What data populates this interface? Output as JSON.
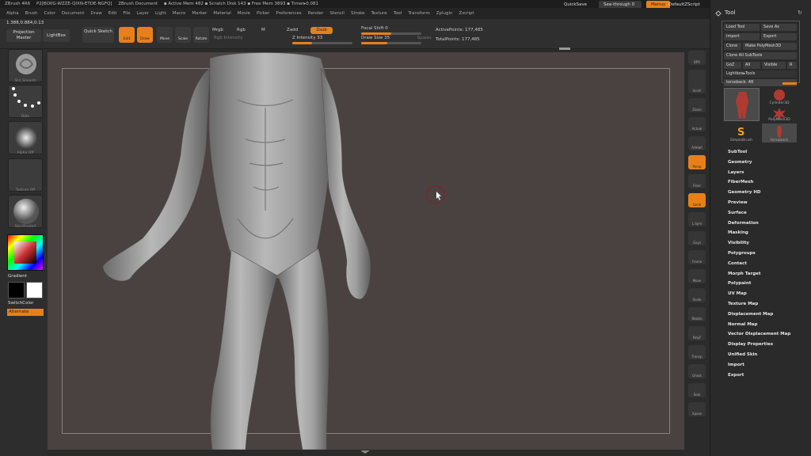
{
  "titlebar": {
    "segments": [
      "ZBrush 4R6",
      "P2[BO0G-WZZE-QIXN-ETDE-NGFQ]",
      "ZBrush Document",
      "▪ Active Mem 482 ▪ Scratch Disk 143 ▪ Free Mem 3893 ▪ Timer▸0.081"
    ],
    "quicksave": "QuickSave",
    "seethrough": "See-through   0",
    "menus": "Menus",
    "defaultzscript": "DefaultZScript"
  },
  "menubar": [
    "Alpha",
    "Brush",
    "Color",
    "Document",
    "Draw",
    "Edit",
    "File",
    "Layer",
    "Light",
    "Macro",
    "Marker",
    "Material",
    "Movie",
    "Picker",
    "Preferences",
    "Render",
    "Stencil",
    "Stroke",
    "Texture",
    "Tool",
    "Transform",
    "Zplugin",
    "Zscript"
  ],
  "coords": "1.388,0.884,0.13",
  "shelf": {
    "projection_master": "Projection Master",
    "lightbox": "LightBox",
    "quick_sketch": "Quick Sketch",
    "edit": "Edit",
    "draw": "Draw",
    "move": "Move",
    "scale": "Scale",
    "rotate": "Rotate",
    "mrgb": "Mrgb",
    "rgb": "Rgb",
    "m": "M",
    "rgb_intensity": "Rgb Intensity",
    "zadd": "Zadd",
    "zsub": "Zsub",
    "z_intensity": "Z Intensity 33",
    "focal_shift": "Focal Shift 0",
    "draw_size": "Draw Size 35",
    "active_points": "ActivePoints: 177,485",
    "total_points": "TotalPoints: 177,485",
    "dynamic": "Dynamic",
    "z_intensity_value": 33,
    "draw_size_value": 35
  },
  "left": {
    "items": [
      "Std_Smooth",
      "Dots",
      "Alpha Off",
      "Texture Off",
      "SkinShade4"
    ],
    "gradient": "Gradient",
    "switchcolor": "SwitchColor",
    "alternate": "Alternate"
  },
  "right": {
    "buttons": [
      "BPR",
      "SPix 3",
      "Scroll",
      "Zoom",
      "Actual",
      "AAHalf",
      "Persp",
      "Floor",
      "Local",
      "L.Sym",
      "Gxyz",
      "Frame",
      "Move",
      "Scale",
      "Rotate",
      "PolyF",
      "Transp",
      "Ghost",
      "Solo",
      "Xpose"
    ],
    "spix": "SPix 3"
  },
  "tool": {
    "title": "Tool",
    "load": "Load Tool",
    "save": "Save As",
    "import": "Import",
    "export": "Export",
    "clone": "Clone",
    "make_polymesh": "Make PolyMesh3D",
    "clone_all": "Clone All SubTools",
    "goz": "GoZ",
    "all": "All",
    "visible": "Visible",
    "r": "R",
    "lightbox_tools": "Lightbox▸Tools",
    "current": "torsoback. 48",
    "thumbs": [
      "torsoback",
      "Cylinder3D",
      "PolyMesh3D",
      "SimpleBrush",
      "torsoback"
    ],
    "menu": [
      "SubTool",
      "Geometry",
      "Layers",
      "FiberMesh",
      "Geometry HD",
      "Preview",
      "Surface",
      "Deformation",
      "Masking",
      "Visibility",
      "Polygroups",
      "Contact",
      "Morph Target",
      "Polypaint",
      "UV Map",
      "Texture Map",
      "Displacement Map",
      "Normal Map",
      "Vector Displacement Map",
      "Display Properties",
      "Unified Skin",
      "Import",
      "Export"
    ]
  }
}
